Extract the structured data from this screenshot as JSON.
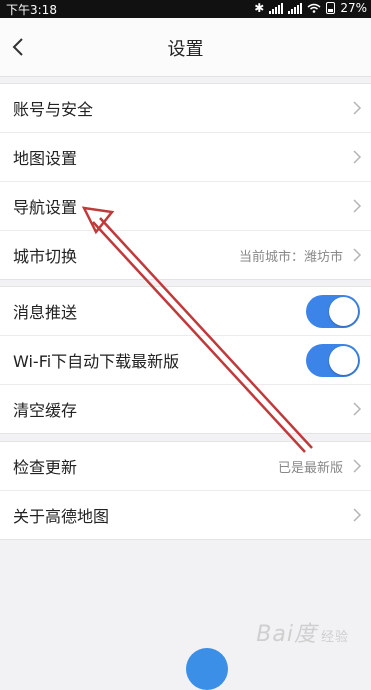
{
  "status_bar": {
    "time": "下午3:18",
    "battery": "27%"
  },
  "header": {
    "title": "设置"
  },
  "groups": [
    {
      "rows": [
        {
          "label": "账号与安全"
        },
        {
          "label": "地图设置"
        },
        {
          "label": "导航设置"
        },
        {
          "label": "城市切换",
          "value": "当前城市：潍坊市"
        }
      ]
    },
    {
      "rows": [
        {
          "label": "消息推送",
          "toggle": "on"
        },
        {
          "label": "Wi-Fi下自动下载最新版",
          "toggle": "on"
        },
        {
          "label": "清空缓存"
        }
      ]
    },
    {
      "rows": [
        {
          "label": "检查更新",
          "value": "已是最新版"
        },
        {
          "label": "关于高德地图"
        }
      ]
    }
  ],
  "watermark": {
    "text": "Bai度",
    "sub": "经验"
  },
  "colors": {
    "accent": "#3d84e8",
    "annotation_arrow": "#c0393b"
  }
}
